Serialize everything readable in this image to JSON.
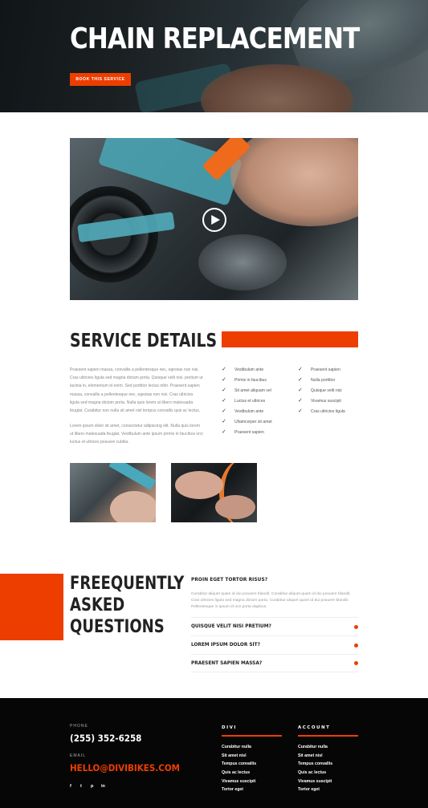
{
  "hero": {
    "title": "CHAIN REPLACEMENT",
    "cta": "BOOK THIS SERVICE"
  },
  "video": {
    "icon": "play-icon"
  },
  "service_details": {
    "title": "SERVICE DETAILS",
    "paragraph1": "Praesent sapien massa, convallis a pellentesque nec, egestas non nisi. Cras ultricies ligula sed magna dictum porta. Quisque velit nisi, pretium ut lacinia in, elementum id enim. Sed porttitor lectus nibh. Praesent sapien massa, convallis a pellentesque nec, egestas non nisi. Cras ultricies ligula sed magna dictum porta. Nulla quis lorem ut libero malesuada feugiat. Curabitur non nulla sit amet nisl tempus convallis quis ac lectus.",
    "paragraph2": "Lorem ipsum dolor sit amet, consectetur adipiscing elit. Nulla quis lorem ut libero malesuada feugiat. Vestibulum ante ipsum primis in faucibus orci luctus et ultrices posuere cubilia.",
    "checklist_left": [
      "Vestibulum ante",
      "Primis in faucibus",
      "Sit amet aliquam vel",
      "Luctus et ultrices",
      "Vestibulum ante",
      "Ullamcorper sit amet",
      "Praesent sapien"
    ],
    "checklist_right": [
      "Praesent sapien",
      "Nulla porttitor",
      "Quisque velit nisi",
      "Vivamus suscipit",
      "Cras ultricies ligula"
    ],
    "check_icon": "check-icon"
  },
  "faq": {
    "title_line1": "FREEQUENTLY",
    "title_line2": "ASKED",
    "title_line3": "QUESTIONS",
    "open_question": "PROIN EGET TORTOR RISUS?",
    "open_answer": "Curabitur aliquet quam id dui posuere blandit. Curabitur aliquet quam id dui posuere blandit. Cras ultricies ligula sed magna dictum porta. Curabitur aliquet quam id dui posuere blandit. Pellentesque in ipsum id orci porta dapibus.",
    "questions": [
      "QUISQUE VELIT NISI PRETIUM?",
      "LOREM IPSUM DOLOR SIT?",
      "PRAESENT SAPIEN MASSA?"
    ]
  },
  "footer": {
    "phone_label": "PHONE",
    "phone": "(255) 352-6258",
    "email_label": "EMAIL",
    "email": "HELLO@DIVIBIKES.COM",
    "social": [
      "f",
      "t",
      "p",
      "in"
    ],
    "col1_title": "DIVI",
    "col1_links": [
      "Curabitur nulla",
      "Sit amet nisl",
      "Tempus convallis",
      "Quis ac lectus",
      "Vivamus suscipit",
      "Tortor eget"
    ],
    "col2_title": "ACCOUNT",
    "col2_links": [
      "Curabitur nulla",
      "Sit amet nisl",
      "Tempus convallis",
      "Quis ac lectus",
      "Vivamus suscipit",
      "Tortor eget"
    ]
  },
  "colors": {
    "accent": "#ed3e00",
    "footer_bg": "#060606"
  }
}
